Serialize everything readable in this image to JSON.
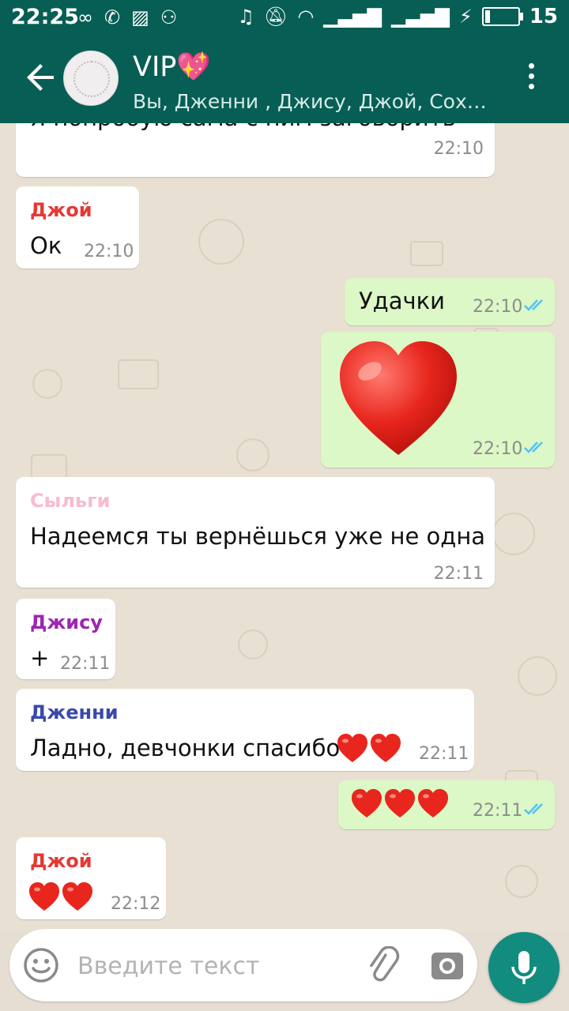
{
  "status_bar": {
    "time": "22:25",
    "battery": "15",
    "battery_level": 0.15
  },
  "header": {
    "title": "VIP",
    "title_emoji": "💖",
    "subtitle": "Вы, Дженни , Джису, Джой, Сохен, С..."
  },
  "messages": [
    {
      "type": "in",
      "text": "Я попробую сама с ним заговорить",
      "time": "22:10"
    },
    {
      "type": "in",
      "sender": "Джой",
      "sender_color": "#e53935",
      "text": "Ок",
      "time": "22:10"
    },
    {
      "type": "out",
      "text": "Удачки",
      "time": "22:10",
      "status": "read"
    },
    {
      "type": "out",
      "emoji": "❤️",
      "time": "22:10",
      "status": "read"
    },
    {
      "type": "in",
      "sender": "Сыльги",
      "sender_color": "#f8bbd0",
      "text": "Надеемся ты вернёшься уже не одна",
      "time": "22:11"
    },
    {
      "type": "in",
      "sender": "Джису",
      "sender_color": "#9c27b0",
      "text": "+",
      "time": "22:11"
    },
    {
      "type": "in",
      "sender": "Дженни",
      "sender_color": "#3949ab",
      "text": "Ладно, девчонки спасибо",
      "hearts": 2,
      "time": "22:11"
    },
    {
      "type": "out",
      "hearts": 3,
      "time": "22:11",
      "status": "read"
    },
    {
      "type": "in",
      "sender": "Джой",
      "sender_color": "#e53935",
      "hearts": 2,
      "time": "22:12"
    }
  ],
  "input": {
    "placeholder": "Введите текст",
    "value": ""
  },
  "colors": {
    "primary": "#075e54",
    "accent": "#128c7e",
    "tick": "#4fc3f7",
    "heart": "#e8261e"
  }
}
